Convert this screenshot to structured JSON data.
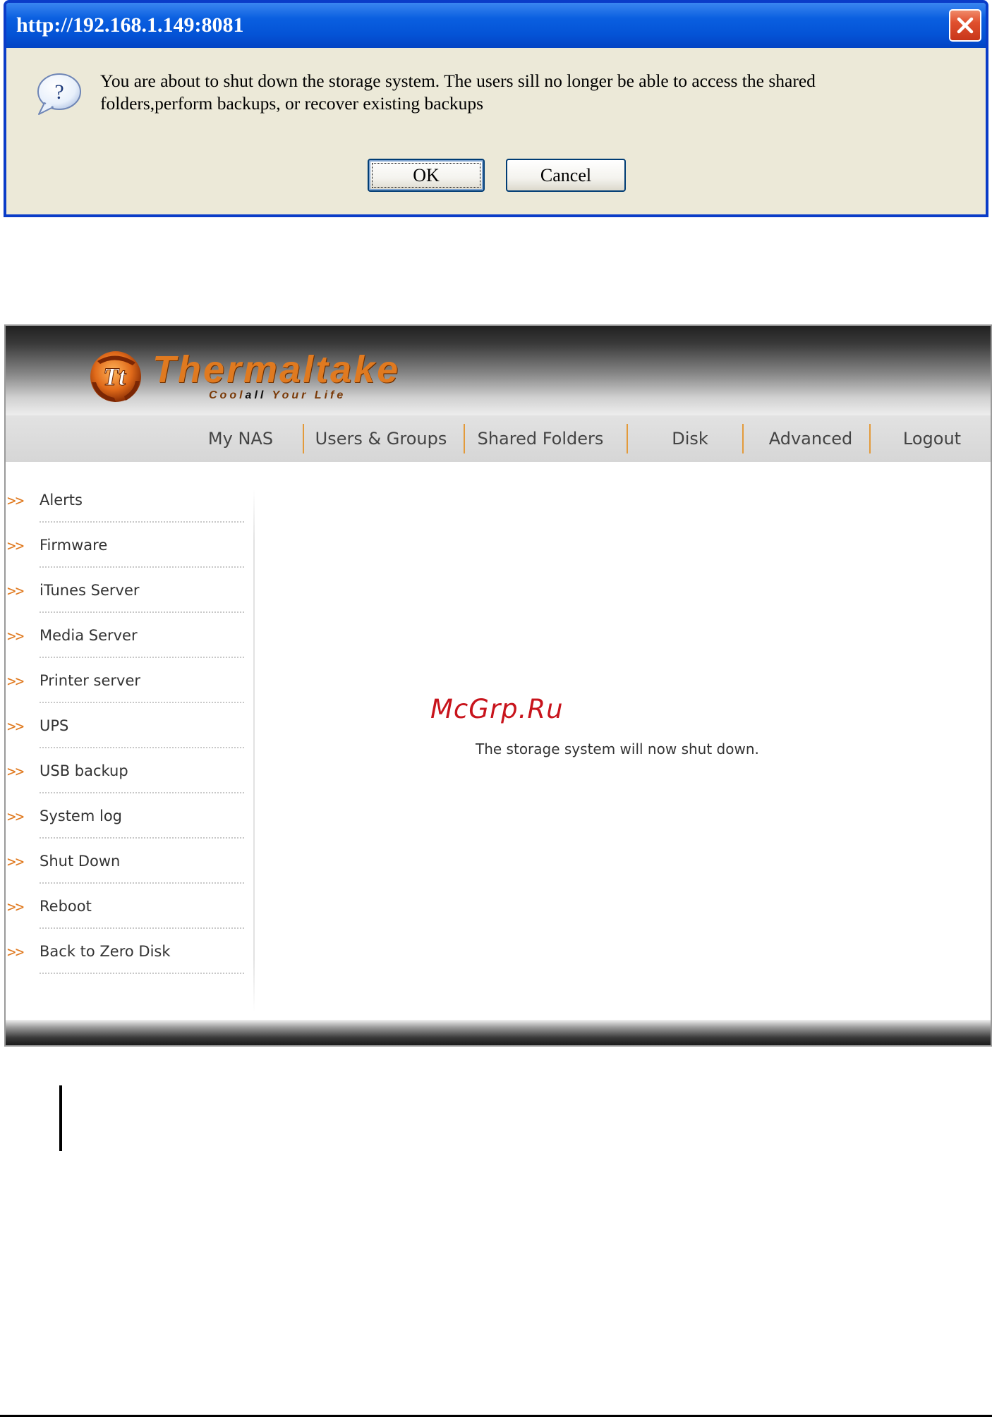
{
  "dialog": {
    "title": "http://192.168.1.149:8081",
    "message": "You are about to shut down the storage system. The users sill no longer be able to access the shared folders,perform backups, or recover existing backups",
    "ok_label": "OK",
    "cancel_label": "Cancel",
    "icon": "question-icon",
    "close_icon": "close-icon"
  },
  "nas": {
    "brand": {
      "name": "Thermaltake",
      "tagline_pre": "Cool",
      "tagline_hl": "all",
      "tagline_post": "Your Life",
      "logo_mark": "Tt"
    },
    "nav": [
      {
        "label": "My NAS"
      },
      {
        "label": "Users & Groups"
      },
      {
        "label": "Shared Folders"
      },
      {
        "label": "Disk"
      },
      {
        "label": "Advanced"
      },
      {
        "label": "Logout"
      }
    ],
    "sidebar": {
      "arrow": ">>",
      "items": [
        {
          "label": "Alerts"
        },
        {
          "label": "Firmware"
        },
        {
          "label": "iTunes Server"
        },
        {
          "label": "Media Server"
        },
        {
          "label": "Printer server"
        },
        {
          "label": "UPS"
        },
        {
          "label": "USB backup"
        },
        {
          "label": "System log"
        },
        {
          "label": "Shut Down"
        },
        {
          "label": "Reboot"
        },
        {
          "label": "Back to Zero Disk"
        }
      ]
    },
    "content": {
      "message": "The storage system will now shut down."
    },
    "watermark": "McGrp.Ru"
  },
  "colors": {
    "dialog_titlebar": "#0453d6",
    "dialog_body": "#ece9d8",
    "accent_orange": "#e07a20",
    "watermark_red": "#c8141c"
  }
}
